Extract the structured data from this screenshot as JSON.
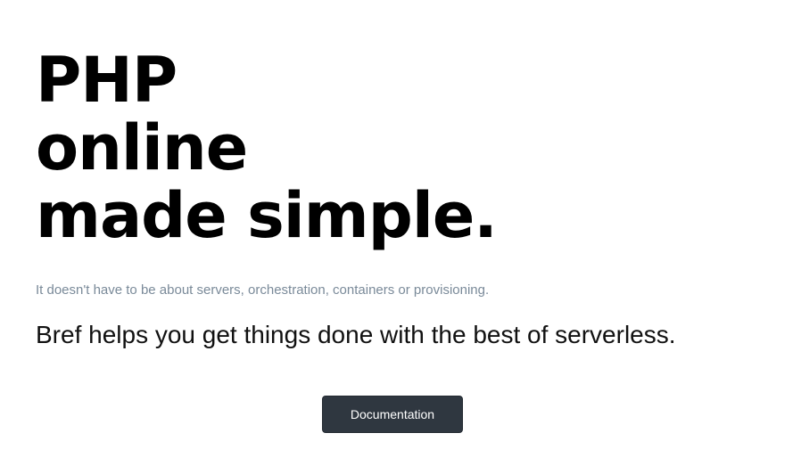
{
  "hero": {
    "title_lines": [
      "PHP",
      "online",
      "made simple."
    ]
  },
  "tagline": "It doesn't have to be about servers, orchestration, containers or provisioning.",
  "subtitle": "Bref helps you get things done with the best of serverless.",
  "cta": {
    "documentation_label": "Documentation"
  },
  "colors": {
    "tagline": "#7a8a99",
    "button_bg": "#2f3740",
    "button_text": "#ffffff"
  }
}
